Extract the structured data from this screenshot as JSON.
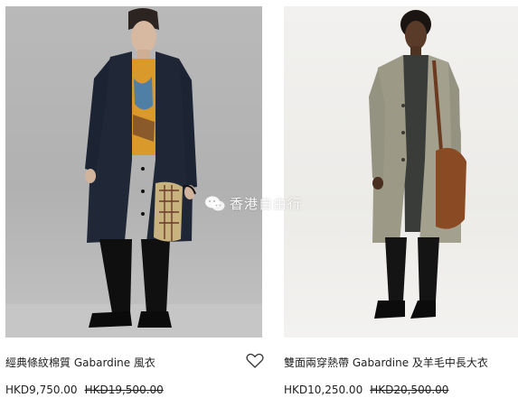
{
  "products": [
    {
      "title": "經典條紋棉質 Gabardine 風衣",
      "price": "HKD9,750.00",
      "original_price": "HKD19,500.00",
      "wishlist_icon": "heart-outline-icon"
    },
    {
      "title": "雙面兩穿熱帶 Gabardine 及羊毛中長大衣",
      "price": "HKD10,250.00",
      "original_price": "HKD20,500.00"
    }
  ],
  "watermark": {
    "text": "香港自由行",
    "icon": "wechat-icon"
  },
  "colors": {
    "text": "#1f1f1f",
    "left_background": "#b5b5b5",
    "right_background": "#efeeec"
  }
}
